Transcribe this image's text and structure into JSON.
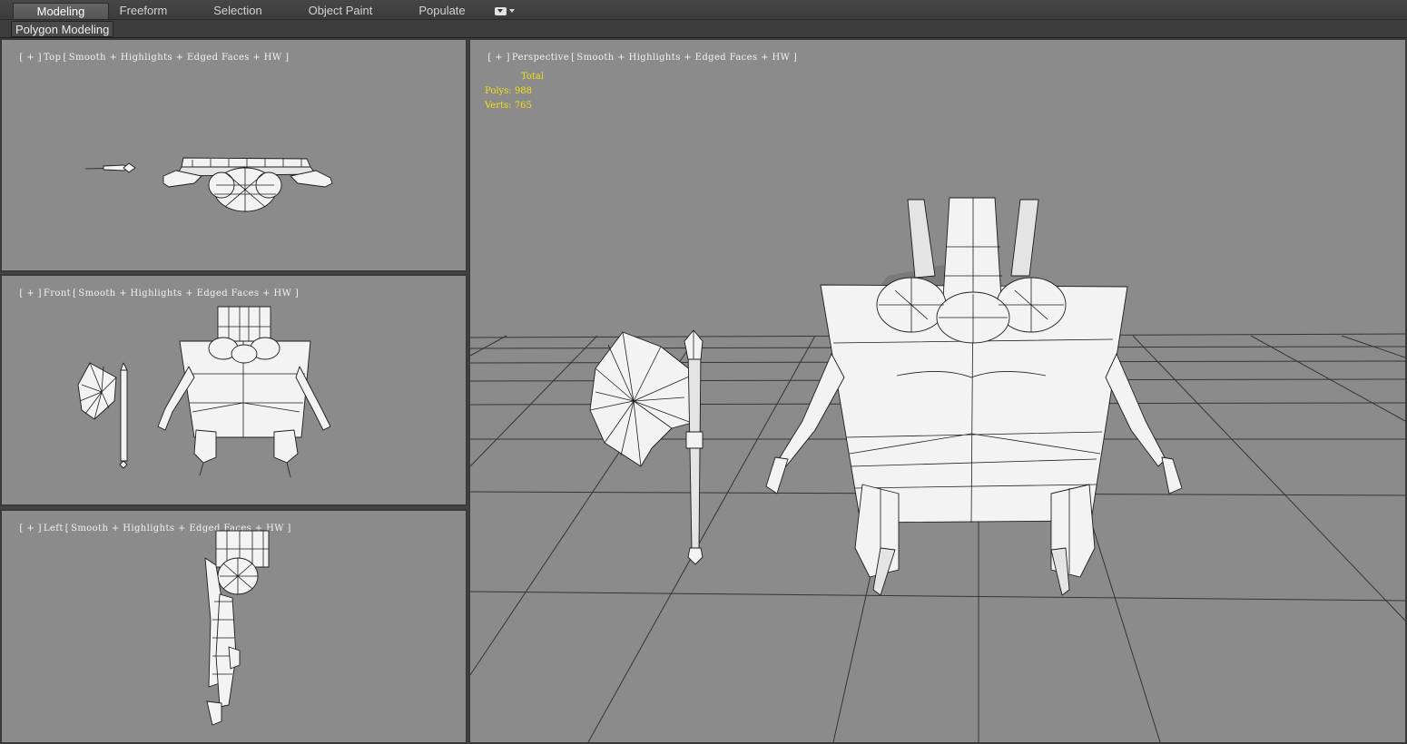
{
  "ribbon": {
    "tabs": [
      "Modeling",
      "Freeform",
      "Selection",
      "Object Paint",
      "Populate"
    ],
    "active_tab": "Modeling",
    "more_icon": "dropdown-box-icon",
    "panel_label": "Polygon Modeling"
  },
  "viewports": {
    "top": {
      "plus": "[ + ]",
      "name": "Top",
      "shading": "Smooth + Highlights + Edged Faces + HW ]"
    },
    "front": {
      "plus": "[ + ]",
      "name": "Front",
      "shading": "Smooth + Highlights + Edged Faces + HW ]"
    },
    "left": {
      "plus": "[ + ]",
      "name": "Left",
      "shading": "Smooth + Highlights + Edged Faces + HW ]"
    },
    "perspective": {
      "plus": "[ + ]",
      "name": "Perspective",
      "shading": "Smooth + Highlights + Edged Faces + HW ]"
    }
  },
  "stats": {
    "total_label": "Total",
    "polys_label": "Polys:",
    "polys": "988",
    "verts_label": "Verts:",
    "verts": "765",
    "color": "#f4e010"
  },
  "colors": {
    "viewport_bg": "#8b8b8b",
    "ui_bg": "#444444",
    "active_tab_text": "#ffffff"
  }
}
